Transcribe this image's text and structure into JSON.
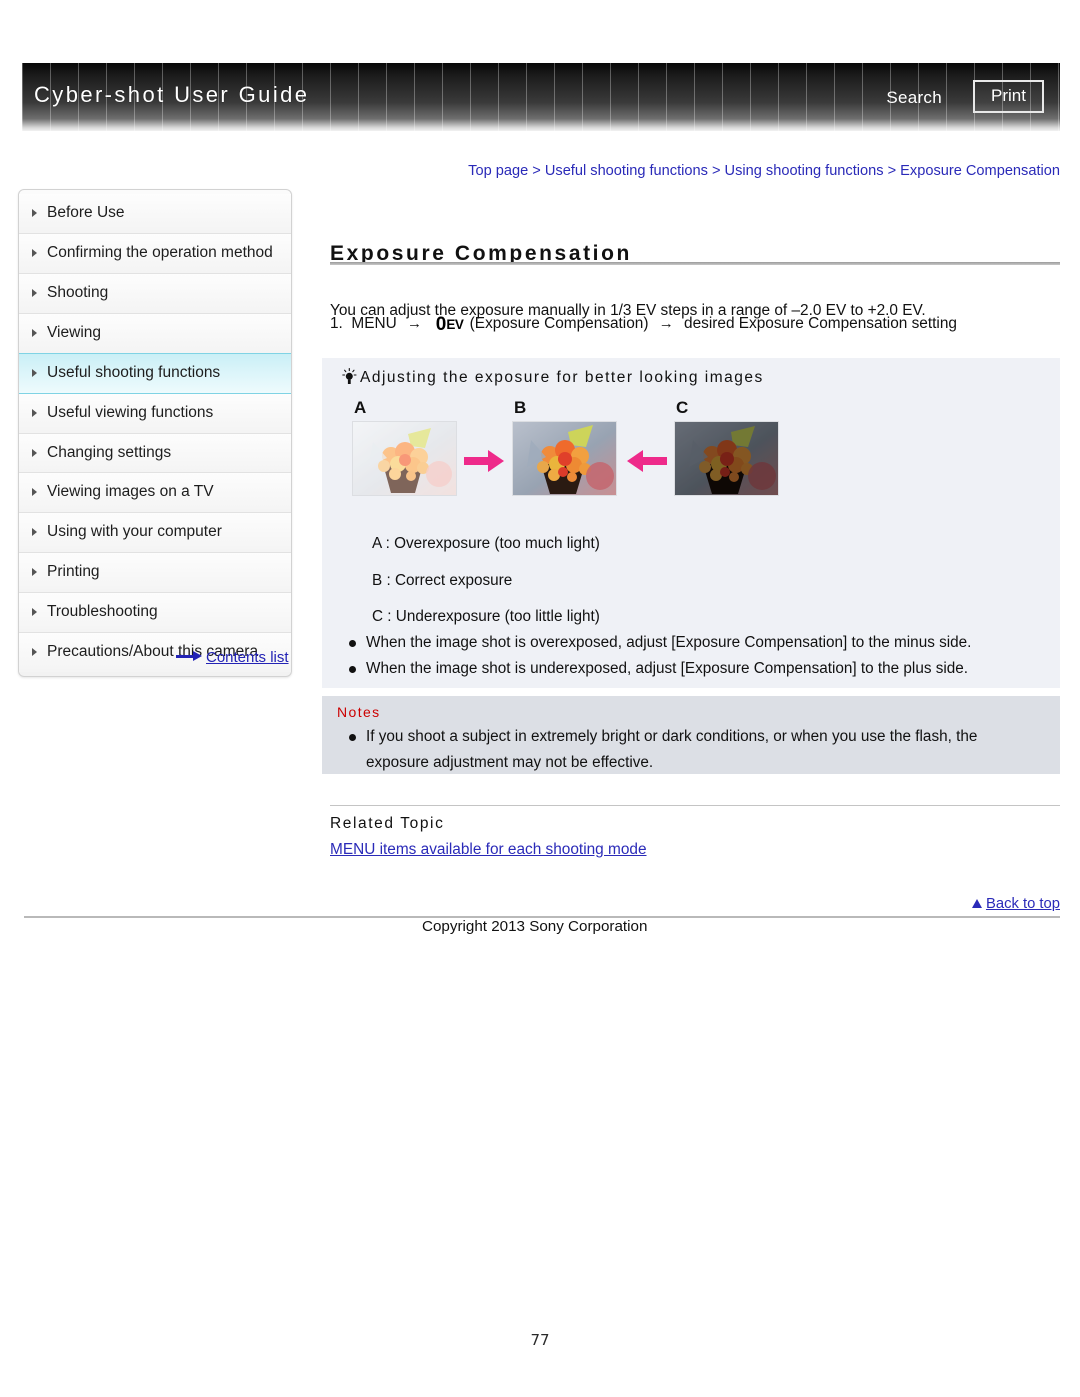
{
  "header": {
    "title": "Cyber-shot User Guide",
    "search_label": "Search",
    "print_label": "Print"
  },
  "sidebar": {
    "items": [
      {
        "label": "Before Use",
        "active": false
      },
      {
        "label": "Confirming the operation method",
        "active": false
      },
      {
        "label": "Shooting",
        "active": false
      },
      {
        "label": "Viewing",
        "active": false
      },
      {
        "label": "Useful shooting functions",
        "active": true
      },
      {
        "label": "Useful viewing functions",
        "active": false
      },
      {
        "label": "Changing settings",
        "active": false
      },
      {
        "label": "Viewing images on a TV",
        "active": false
      },
      {
        "label": "Using with your computer",
        "active": false
      },
      {
        "label": "Printing",
        "active": false
      },
      {
        "label": "Troubleshooting",
        "active": false
      },
      {
        "label": "Precautions/About this camera",
        "active": false
      }
    ],
    "contents_link": "Contents list"
  },
  "main": {
    "breadcrumb": "Top page > Useful shooting functions > Using shooting functions > Exposure Compensation",
    "page_title": "Exposure Compensation",
    "intro": "You can adjust the exposure manually in 1/3 EV steps in a range of –2.0 EV to +2.0 EV.",
    "step": {
      "number": "1.",
      "menu_label": "MENU",
      "icon_zero": "0",
      "icon_ev": "EV",
      "icon_name": "exposure-compensation-icon",
      "paren": "(Exposure Compensation)",
      "tail": "desired Exposure Compensation setting",
      "arrow": "→"
    },
    "tip": {
      "heading": "Adjusting the exposure for better looking images",
      "photos": [
        {
          "label": "A",
          "caption": "A : Overexposure (too much light)",
          "kind": "overexposed"
        },
        {
          "label": "B",
          "caption": "B : Correct exposure",
          "kind": "correct"
        },
        {
          "label": "C",
          "caption": "C : Underexposure (too little light)",
          "kind": "underexposed"
        }
      ],
      "bullets": [
        "When the image shot is overexposed, adjust [Exposure Compensation] to the minus side.",
        "When the image shot is underexposed, adjust [Exposure Compensation] to the plus side."
      ]
    },
    "notes": {
      "heading": "Notes",
      "items": [
        "If you shoot a subject in extremely bright or dark conditions, or when you use the flash, the exposure adjustment may not be effective."
      ]
    },
    "related": {
      "heading": "Related Topic",
      "link": "MENU items available for each shooting mode"
    }
  },
  "footer": {
    "back_to_top": "Back to top",
    "copyright": "Copyright 2013 Sony Corporation",
    "page_number": "77"
  },
  "colors": {
    "link_blue": "#2a2ab8",
    "notes_red": "#cc0000",
    "tip_bg": "#eff1f6",
    "notes_bg": "#dcdfe5",
    "active_nav": "#c9eff6",
    "arrow_pink": "#ee2a8a"
  }
}
